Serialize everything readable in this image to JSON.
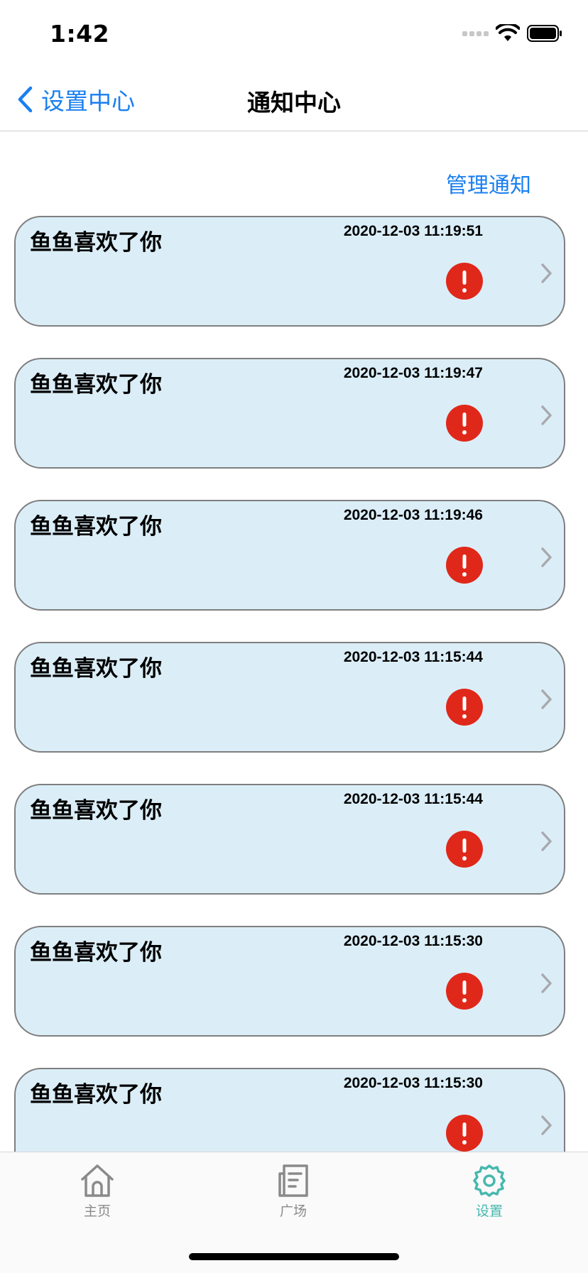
{
  "status_bar": {
    "time": "1:42"
  },
  "nav": {
    "back_label": "设置中心",
    "title": "通知中心"
  },
  "manage_label": "管理通知",
  "notifications": [
    {
      "title": "鱼鱼喜欢了你",
      "time": "2020-12-03 11:19:51",
      "icon": "alert-icon"
    },
    {
      "title": "鱼鱼喜欢了你",
      "time": "2020-12-03 11:19:47",
      "icon": "alert-icon"
    },
    {
      "title": "鱼鱼喜欢了你",
      "time": "2020-12-03 11:19:46",
      "icon": "alert-icon"
    },
    {
      "title": "鱼鱼喜欢了你",
      "time": "2020-12-03 11:15:44",
      "icon": "alert-icon"
    },
    {
      "title": "鱼鱼喜欢了你",
      "time": "2020-12-03 11:15:44",
      "icon": "alert-icon"
    },
    {
      "title": "鱼鱼喜欢了你",
      "time": "2020-12-03 11:15:30",
      "icon": "alert-icon"
    },
    {
      "title": "鱼鱼喜欢了你",
      "time": "2020-12-03 11:15:30",
      "icon": "alert-icon"
    }
  ],
  "tabs": [
    {
      "label": "主页",
      "icon": "home-icon",
      "active": false
    },
    {
      "label": "广场",
      "icon": "newspaper-icon",
      "active": false
    },
    {
      "label": "设置",
      "icon": "gear-icon",
      "active": true
    }
  ],
  "colors": {
    "accent": "#1a7ff0",
    "card_background": "#dbeef8",
    "alert": "#e0281a",
    "active_tab": "#46b8ae"
  }
}
